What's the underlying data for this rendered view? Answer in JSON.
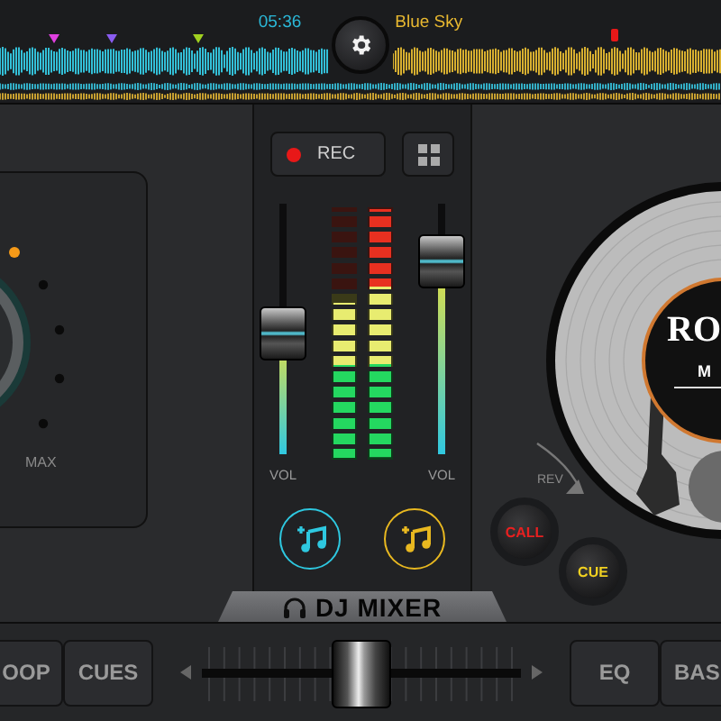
{
  "waveform": {
    "time": "05:36",
    "title": "Blue Sky",
    "cues": [
      {
        "color": "#e040e0"
      },
      {
        "color": "#8a5cf0"
      },
      {
        "color": "#a0d020"
      }
    ]
  },
  "left_deck": {
    "knob_label": "MAX"
  },
  "mixer": {
    "rec_button": "REC",
    "left_fader": {
      "level": 0.48,
      "label": "VOL"
    },
    "right_fader": {
      "level": 0.77,
      "label": "VOL"
    },
    "meter_left": {
      "level": 0.625
    },
    "meter_right": {
      "level": 1
    },
    "title": "DJ MIXER"
  },
  "right_deck": {
    "record_label": [
      "RO",
      "M"
    ],
    "rev_label": "REV",
    "call_button": "CALL",
    "cue_button": "CUE"
  },
  "bottom_bar": {
    "left_buttons": [
      "OOP",
      "CUES"
    ],
    "crossfader": {
      "level": 0.5
    },
    "right_buttons": [
      "EQ",
      "BAS"
    ]
  }
}
